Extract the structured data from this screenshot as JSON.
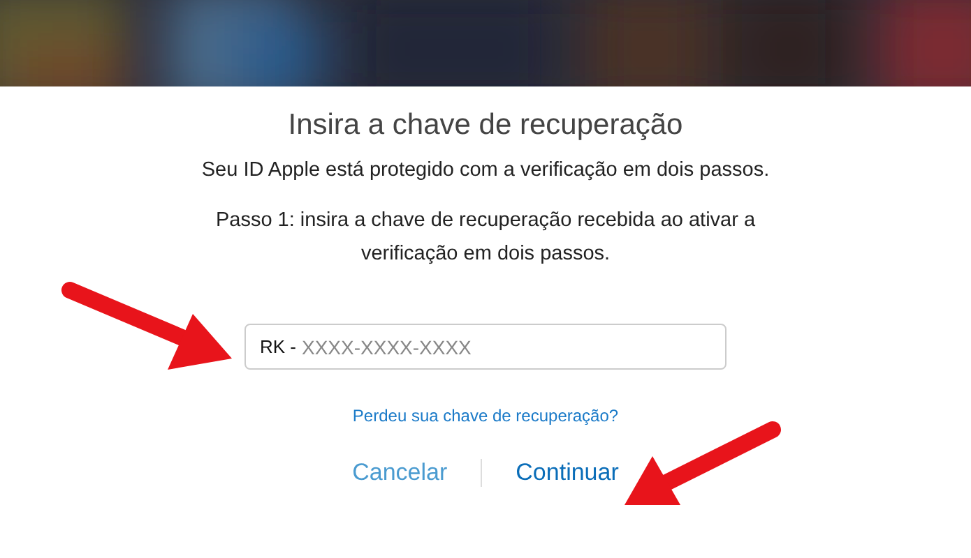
{
  "title": "Insira a chave de recuperação",
  "subtitle": "Seu ID Apple está protegido com a verificação em dois passos.",
  "instruction": "Passo 1: insira a chave de recuperação recebida ao ativar a verificação em dois passos.",
  "key_field": {
    "prefix": "RK -",
    "placeholder": "XXXX-XXXX-XXXX"
  },
  "lost_key_link": "Perdeu sua chave de recuperação?",
  "buttons": [
    {
      "label": "Cancelar",
      "primary": false
    },
    {
      "label": "Continuar",
      "primary": true
    }
  ]
}
